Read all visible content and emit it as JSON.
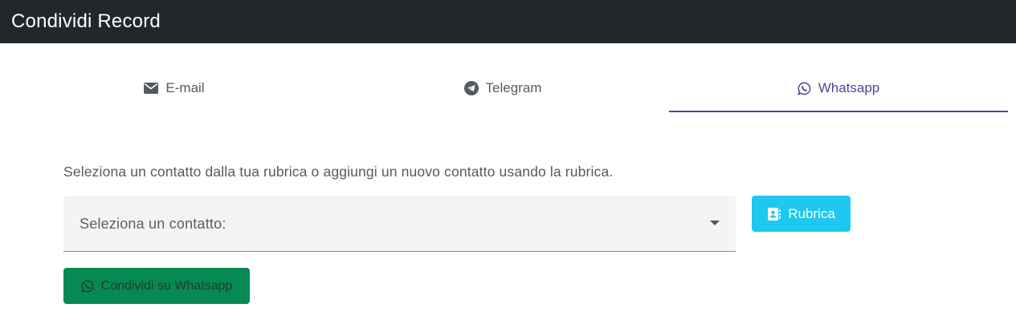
{
  "header": {
    "title": "Condividi Record"
  },
  "tabs": [
    {
      "label": "E-mail",
      "icon": "envelope-icon",
      "active": false
    },
    {
      "label": "Telegram",
      "icon": "telegram-icon",
      "active": false
    },
    {
      "label": "Whatsapp",
      "icon": "whatsapp-icon",
      "active": true
    }
  ],
  "main": {
    "helper_text": "Seleziona un contatto dalla tua rubrica o aggiungi un nuovo contatto usando la rubrica.",
    "contact_select": {
      "placeholder": "Seleziona un contatto:"
    },
    "rubrica_button": {
      "label": "Rubrica",
      "icon": "address-book-icon"
    },
    "share_button": {
      "label": "Condividi su Whatsapp",
      "icon": "whatsapp-icon"
    }
  },
  "colors": {
    "header_bg": "#23272b",
    "active_tab": "#4a4799",
    "rubrica_bg": "#1ec8ee",
    "share_bg": "#078a52"
  }
}
